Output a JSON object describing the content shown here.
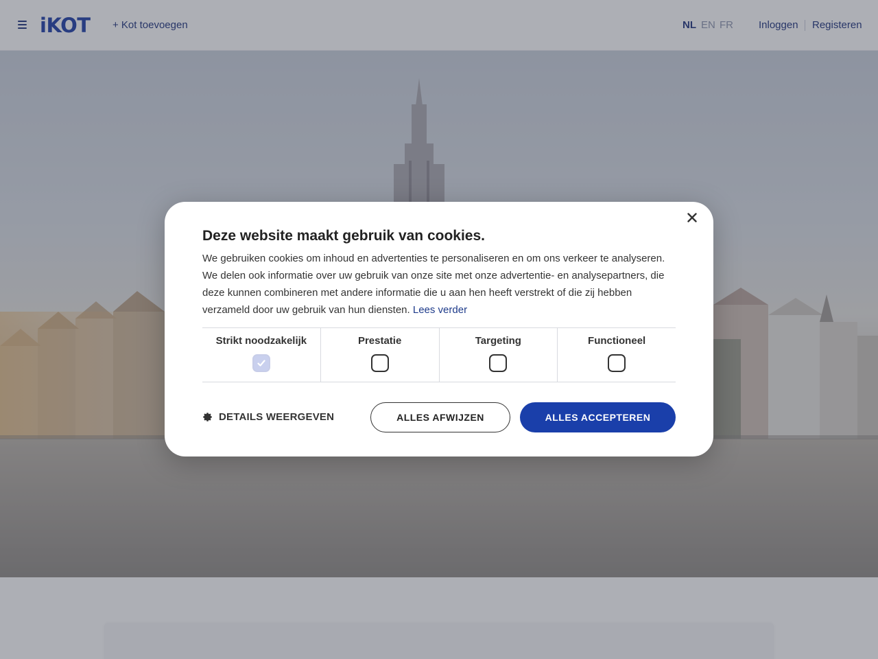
{
  "header": {
    "logo": "iKOT",
    "add_kot": "+ Kot toevoegen",
    "languages": [
      {
        "code": "NL",
        "active": true
      },
      {
        "code": "EN",
        "active": false
      },
      {
        "code": "FR",
        "active": false
      }
    ],
    "login": "Inloggen",
    "register": "Registeren"
  },
  "cookie_dialog": {
    "title": "Deze website maakt gebruik van cookies.",
    "body": "We gebruiken cookies om inhoud en advertenties te personaliseren en om ons verkeer te analyseren. We delen ook informatie over uw gebruik van onze site met onze advertentie- en analysepartners, die deze kunnen combineren met andere informatie die u aan hen heeft verstrekt of die zij hebben verzameld door uw gebruik van hun diensten.",
    "read_more": "Lees verder",
    "categories": [
      {
        "label": "Strikt noodzakelijk",
        "checked": true,
        "disabled": true
      },
      {
        "label": "Prestatie",
        "checked": false,
        "disabled": false
      },
      {
        "label": "Targeting",
        "checked": false,
        "disabled": false
      },
      {
        "label": "Functioneel",
        "checked": false,
        "disabled": false
      }
    ],
    "details": "DETAILS WEERGEVEN",
    "reject_all": "ALLES AFWIJZEN",
    "accept_all": "ALLES ACCEPTEREN"
  },
  "colors": {
    "brand": "#1b3ba6",
    "nav_text": "#1a2f7a",
    "accept_button": "#1a3faa",
    "inactive_language": "#8b93ac"
  },
  "icons": {
    "menu": "hamburger-icon",
    "close": "close-icon",
    "details": "gear-icon",
    "checked": "checkmark-icon"
  }
}
